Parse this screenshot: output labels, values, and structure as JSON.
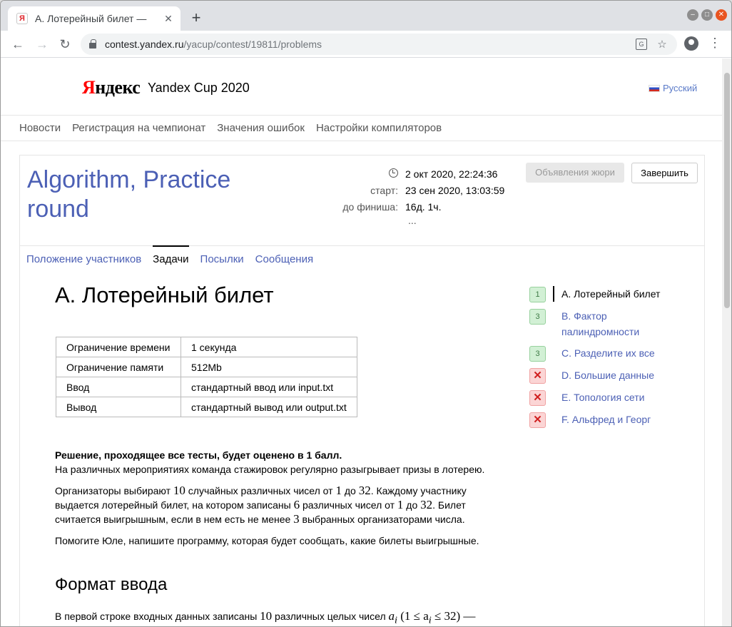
{
  "browser": {
    "tab_title": "A. Лотерейный билет —",
    "tab_close": "✕",
    "new_tab": "+",
    "url_host": "contest.yandex.ru",
    "url_path": "/yacup/contest/19811/problems"
  },
  "header": {
    "logo_red": "Я",
    "logo_rest": "ндекс",
    "title": "Yandex Cup 2020",
    "language": "Русский"
  },
  "topnav": [
    "Новости",
    "Регистрация на чемпионат",
    "Значения ошибок",
    "Настройки компиляторов"
  ],
  "contest": {
    "title": "Algorithm, Practice round",
    "current_time": "2 окт 2020, 22:24:36",
    "start_label": "старт:",
    "start_value": "23 сен 2020, 13:03:59",
    "finish_label": "до финиша:",
    "finish_value": "16д. 1ч.",
    "ellipsis": "...",
    "jury_button": "Объявления жюри",
    "finish_button": "Завершить"
  },
  "tabs": [
    "Положение участников",
    "Задачи",
    "Посылки",
    "Сообщения"
  ],
  "problem": {
    "title": "A. Лотерейный билет",
    "limits": [
      {
        "key": "Ограничение времени",
        "value": "1 секунда"
      },
      {
        "key": "Ограничение памяти",
        "value": "512Mb"
      },
      {
        "key": "Ввод",
        "value": "стандартный ввод или input.txt"
      },
      {
        "key": "Вывод",
        "value": "стандартный вывод или output.txt"
      }
    ],
    "score_note": "Решение, проходящее все тесты, будет оценено в 1 балл.",
    "p1": "На различных мероприятиях команда стажировок регулярно разыгрывает призы в лотерею.",
    "p2_a": "Организаторы выбирают ",
    "p2_n1": "10",
    "p2_b": " случайных различных чисел от ",
    "p2_n2": "1",
    "p2_c": " до ",
    "p2_n3": "32",
    "p2_d": ". Каждому участнику выдается лотерейный билет, на котором записаны ",
    "p2_n4": "6",
    "p2_e": " различных чисел от ",
    "p2_n5": "1",
    "p2_f": " до ",
    "p2_n6": "32",
    "p2_g": ". Билет считается выигрышным, если в нем есть не менее ",
    "p2_n7": "3",
    "p2_h": " выбранных организаторами числа.",
    "p3": "Помогите Юле, напишите программу, которая будет сообщать, какие билеты выигрышные.",
    "section_input": "Формат ввода",
    "input_a": "В первой строке входных данных записаны ",
    "input_n": "10",
    "input_b": " различных целых чисел ",
    "input_math": "(1 ≤ a",
    "input_math2": " ≤ 32) —"
  },
  "problem_list": [
    {
      "badge": "1",
      "status": "ok",
      "name": "A. Лотерейный билет",
      "current": true
    },
    {
      "badge": "3",
      "status": "ok",
      "name": "B. Фактор палиндромности",
      "current": false
    },
    {
      "badge": "3",
      "status": "ok",
      "name": "C. Разделите их все",
      "current": false
    },
    {
      "badge": "✕",
      "status": "fail",
      "name": "D. Большие данные",
      "current": false
    },
    {
      "badge": "✕",
      "status": "fail",
      "name": "E. Топология сети",
      "current": false
    },
    {
      "badge": "✕",
      "status": "fail",
      "name": "F. Альфред и Георг",
      "current": false
    }
  ]
}
